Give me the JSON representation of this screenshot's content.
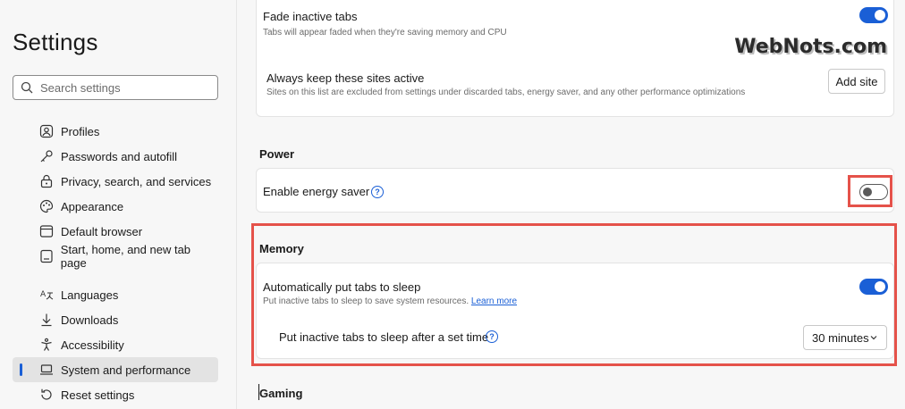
{
  "sidebar": {
    "title": "Settings",
    "search_placeholder": "Search settings",
    "items": [
      {
        "label": "Profiles",
        "icon": "profile-icon"
      },
      {
        "label": "Passwords and autofill",
        "icon": "key-icon"
      },
      {
        "label": "Privacy, search, and services",
        "icon": "lock-icon"
      },
      {
        "label": "Appearance",
        "icon": "palette-icon"
      },
      {
        "label": "Default browser",
        "icon": "browser-icon"
      },
      {
        "label": "Start, home, and new tab page",
        "icon": "home-page-icon"
      },
      {
        "label": "Languages",
        "icon": "languages-icon"
      },
      {
        "label": "Downloads",
        "icon": "download-icon"
      },
      {
        "label": "Accessibility",
        "icon": "accessibility-icon"
      },
      {
        "label": "System and performance",
        "icon": "laptop-icon",
        "active": true
      },
      {
        "label": "Reset settings",
        "icon": "reset-icon"
      }
    ]
  },
  "main": {
    "fade": {
      "title": "Fade inactive tabs",
      "subtitle": "Tabs will appear faded when they're saving memory and CPU",
      "enabled": true
    },
    "keep_active": {
      "title": "Always keep these sites active",
      "subtitle": "Sites on this list are excluded from settings under discarded tabs, energy saver, and any other performance optimizations",
      "button": "Add site"
    },
    "power": {
      "heading": "Power",
      "energy_saver_label": "Enable energy saver",
      "enabled": false
    },
    "memory": {
      "heading": "Memory",
      "sleep_title": "Automatically put tabs to sleep",
      "sleep_subtitle": "Put inactive tabs to sleep to save system resources.",
      "learn_more": "Learn more",
      "enabled": true,
      "timer_label": "Put inactive tabs to sleep after a set time",
      "timer_value": "30 minutes"
    },
    "gaming": {
      "heading": "Gaming"
    }
  },
  "watermark": "WebNots.com",
  "colors": {
    "accent": "#1a5fd6",
    "highlight": "#e5524a"
  }
}
